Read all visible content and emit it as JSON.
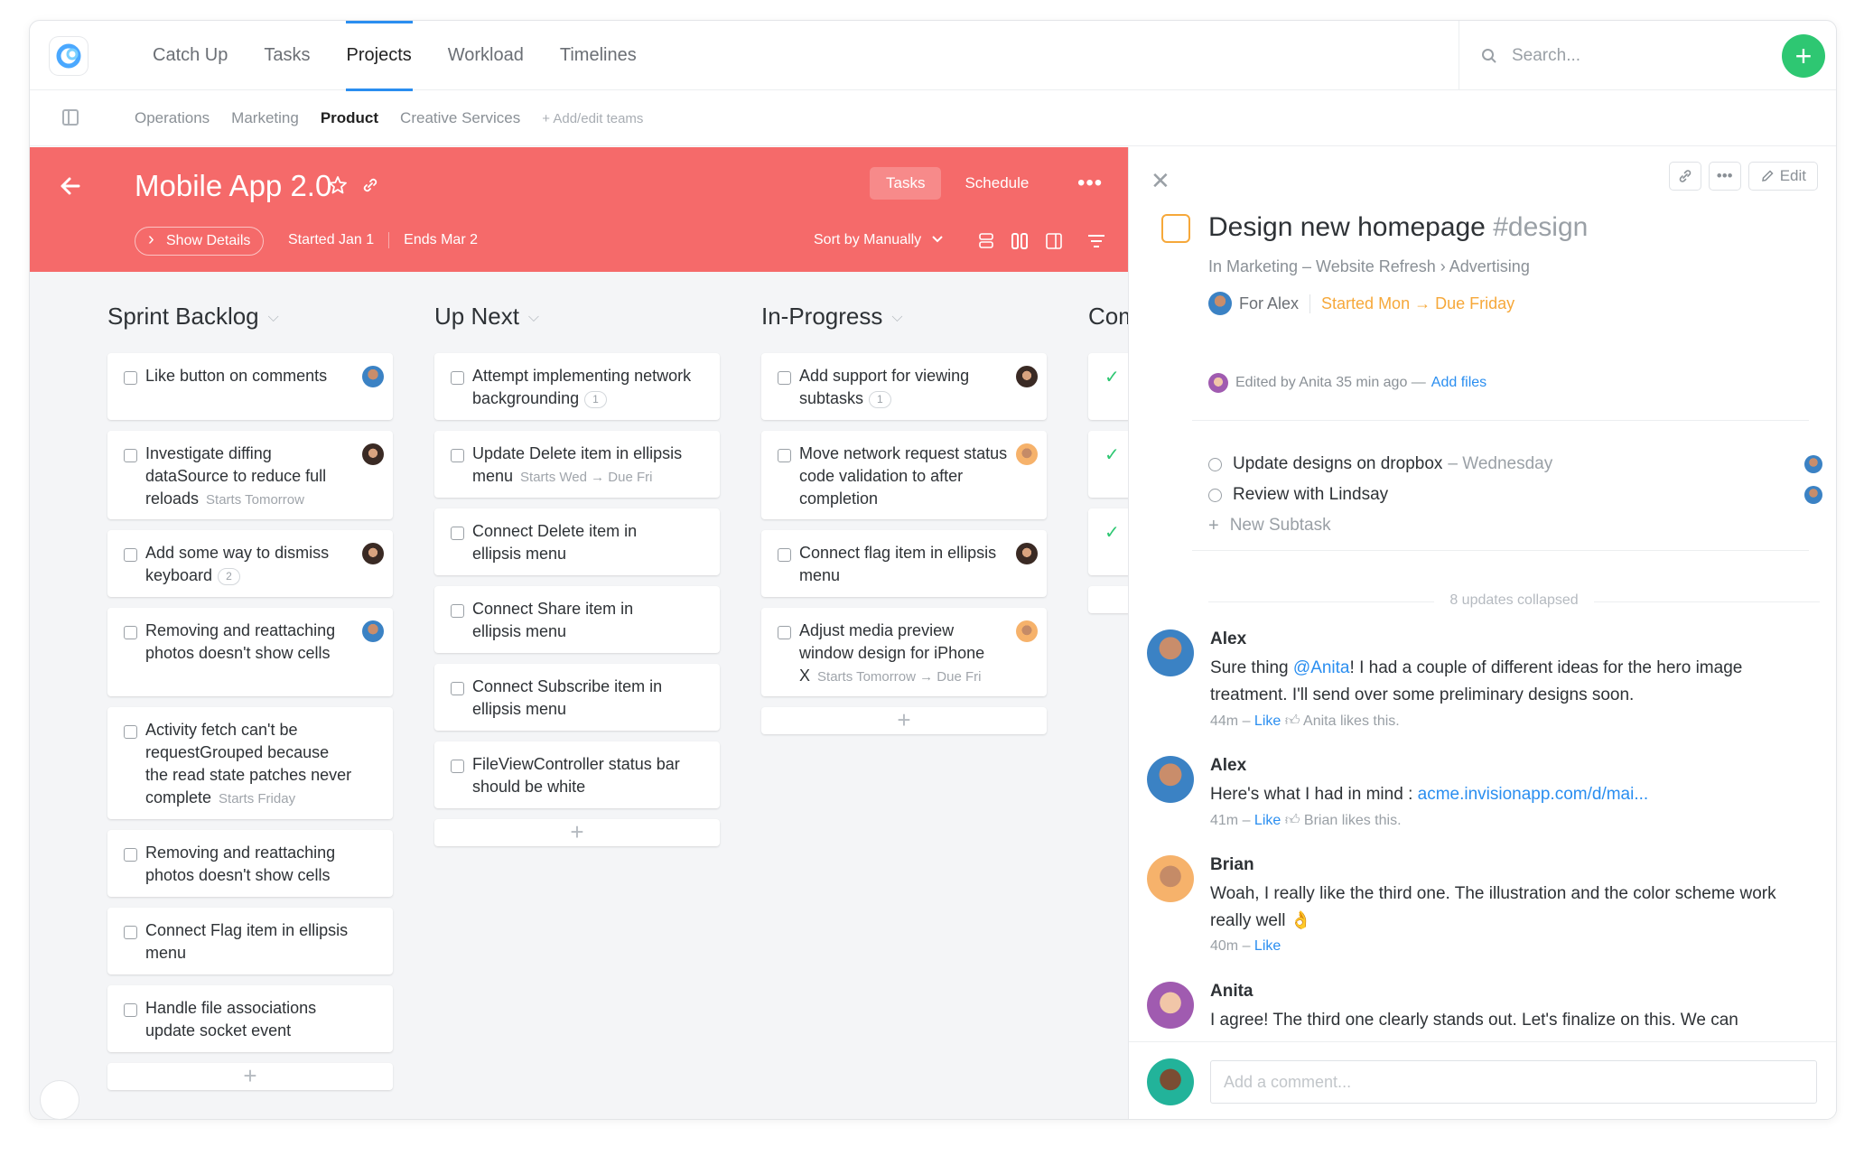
{
  "nav": {
    "items": [
      "Catch Up",
      "Tasks",
      "Projects",
      "Workload",
      "Timelines"
    ],
    "active": "Projects"
  },
  "search": {
    "placeholder": "Search..."
  },
  "add_button": "+",
  "teams": {
    "items": [
      "Operations",
      "Marketing",
      "Product",
      "Creative Services"
    ],
    "active": "Product",
    "add_label": "+ Add/edit teams"
  },
  "project": {
    "title": "Mobile App 2.0",
    "tabs": [
      "Tasks",
      "Schedule"
    ],
    "active_tab": "Tasks",
    "show_details": "Show Details",
    "started": "Started Jan 1",
    "ends": "Ends Mar 2",
    "sort": "Sort by Manually",
    "header_color": "#f56a6a"
  },
  "columns": {
    "sprint_backlog": {
      "title": "Sprint Backlog",
      "cards": [
        {
          "text": "Like button on comments"
        },
        {
          "text": "Investigate diffing dataSource to reduce full reloads",
          "sub": "Starts Tomorrow"
        },
        {
          "text": "Add some way to dismiss keyboard",
          "badge": "2"
        },
        {
          "text": "Removing and reattaching photos doesn't show cells"
        },
        {
          "text": "Activity fetch can't be requestGrouped because the read state patches never complete",
          "sub": "Starts Friday"
        },
        {
          "text": "Removing and reattaching photos doesn't show cells"
        },
        {
          "text": "Connect Flag item in ellipsis menu"
        },
        {
          "text": "Handle file associations update socket event"
        }
      ]
    },
    "up_next": {
      "title": "Up Next",
      "cards": [
        {
          "text": "Attempt implementing network backgrounding",
          "badge": "1"
        },
        {
          "text": "Update Delete item in ellipsis menu",
          "sub": "Starts Wed → Due Fri"
        },
        {
          "text": "Connect Delete item in ellipsis menu"
        },
        {
          "text": "Connect Share item in ellipsis menu"
        },
        {
          "text": "Connect Subscribe item in ellipsis menu"
        },
        {
          "text": "FileViewController status bar should be white"
        }
      ]
    },
    "in_progress": {
      "title": "In-Progress",
      "cards": [
        {
          "text": "Add support for viewing subtasks",
          "badge": "1"
        },
        {
          "text": "Move network request status code validation to after completion"
        },
        {
          "text": "Connect flag item in ellipsis menu"
        },
        {
          "text": "Adjust media preview window design for iPhone X",
          "sub": "Starts Tomorrow → Due Fri"
        }
      ]
    },
    "completed": {
      "title": "Com"
    }
  },
  "task": {
    "title": "Design new homepage",
    "tag": "#design",
    "path": "In Marketing – Website Refresh › Advertising",
    "for": "For Alex",
    "dates": "Started Mon → Due Friday",
    "edited": "Edited by Anita 35 min ago —",
    "add_files": "Add files",
    "edit_label": "Edit",
    "subtasks": [
      {
        "text": "Update designs on dropbox",
        "when": "– Wednesday"
      },
      {
        "text": "Review with Lindsay",
        "when": ""
      }
    ],
    "new_subtask": "New Subtask",
    "collapsed": "8 updates collapsed",
    "accent": "#f6a83a"
  },
  "comments": [
    {
      "author": "Alex",
      "mention": "@Anita",
      "pre": "Sure thing ",
      "text": "! I had a couple of different ideas for the hero image treatment. I'll send over some preliminary designs soon.",
      "time": "44m –",
      "like": "Like",
      "likes": "Anita likes this."
    },
    {
      "author": "Alex",
      "pre": "Here's what I had in mind : ",
      "url": "acme.invisionapp.com/d/mai...",
      "time": "41m –",
      "like": "Like",
      "likes": "Brian likes this."
    },
    {
      "author": "Brian",
      "text": "Woah, I really like the third one. The illustration and the color scheme work really well 👌",
      "time": "40m –",
      "like": "Like"
    },
    {
      "author": "Anita",
      "text": "I agree! The third one clearly stands out. Let's finalize on this. We can"
    }
  ],
  "composer": {
    "placeholder": "Add a comment..."
  }
}
